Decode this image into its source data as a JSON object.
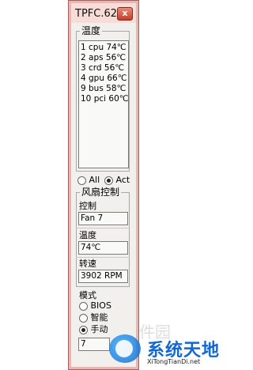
{
  "window": {
    "title": "TPFC.62",
    "close_label": "x"
  },
  "temperature": {
    "legend": "温度",
    "lines": [
      "1 cpu 74℃",
      "2 aps 56℃",
      "3 crd 56℃",
      "4 gpu 66℃",
      "9 bus 58℃",
      "10 pci 60℃"
    ]
  },
  "filter": {
    "options": [
      {
        "label": "All",
        "selected": false
      },
      {
        "label": "Act",
        "selected": true
      }
    ]
  },
  "fan_control": {
    "legend": "风扇控制",
    "control_label": "控制",
    "control_value": "Fan 7",
    "temp_label": "温度",
    "temp_value": "74℃",
    "speed_label": "转速",
    "speed_value": "3902 RPM"
  },
  "mode": {
    "label": "模式",
    "options": [
      {
        "label": "BIOS",
        "selected": false
      },
      {
        "label": "智能",
        "selected": false
      },
      {
        "label": "手动",
        "selected": true
      }
    ],
    "manual_value": "7"
  },
  "watermark": {
    "title": "系统天地",
    "subtitle": "XiTongTianDi.net",
    "faint_text": "当下软件园"
  },
  "colors": {
    "frame_border": "#a06060",
    "title_bg": "#f7dcd8",
    "close_button": "#c2402a",
    "watermark_blue": "#1466d1"
  }
}
